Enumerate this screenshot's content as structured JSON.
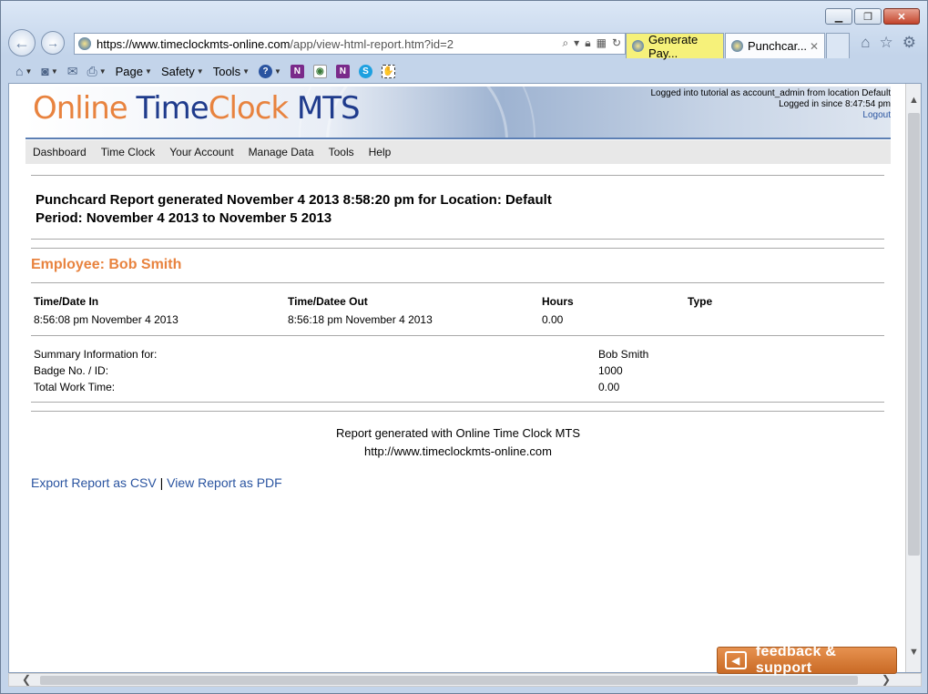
{
  "browser": {
    "address": {
      "host": "https://www.timeclockmts-online.com",
      "path": "/app/view-html-report.htm?id=2"
    },
    "tabs": [
      {
        "label": "Generate Pay...",
        "color": "#f6f17a"
      },
      {
        "label": "Punchcar...",
        "color": "#fbfcfe"
      }
    ],
    "command_bar": {
      "page": "Page",
      "safety": "Safety",
      "tools": "Tools"
    }
  },
  "header": {
    "logo": {
      "w1": "Online",
      "w2": "Time",
      "w3": "Clock",
      "w4": "MTS"
    },
    "login_line1": "Logged into tutorial as account_admin from location Default",
    "login_line2": "Logged in since 8:47:54 pm",
    "logout": "Logout"
  },
  "menu": [
    "Dashboard",
    "Time Clock",
    "Your Account",
    "Manage Data",
    "Tools",
    "Help"
  ],
  "report": {
    "title_line1": "Punchcard Report generated November 4 2013 8:58:20 pm for Location: Default",
    "title_line2": "Period: November 4 2013 to November 5 2013",
    "employee": "Employee: Bob Smith",
    "columns": [
      "Time/Date In",
      "Time/Datee Out",
      "Hours",
      "Type"
    ],
    "rows": [
      [
        "8:56:08 pm November 4 2013",
        "8:56:18 pm November 4 2013",
        "0.00",
        ""
      ]
    ],
    "summary": [
      {
        "label": "Summary Information for:",
        "value": "Bob Smith"
      },
      {
        "label": "Badge No. / ID:",
        "value": "1000"
      },
      {
        "label": "Total Work Time:",
        "value": "0.00"
      }
    ],
    "footer_line1": "Report generated with Online Time Clock MTS",
    "footer_line2": "http://www.timeclockmts-online.com",
    "export_csv": "Export Report as CSV",
    "separator": "|",
    "view_pdf": "View Report as PDF"
  },
  "feedback": "feedback & support",
  "colors": {
    "accent_orange": "#e8833f",
    "brand_blue": "#1f3b8c",
    "link_blue": "#2a54a0"
  }
}
